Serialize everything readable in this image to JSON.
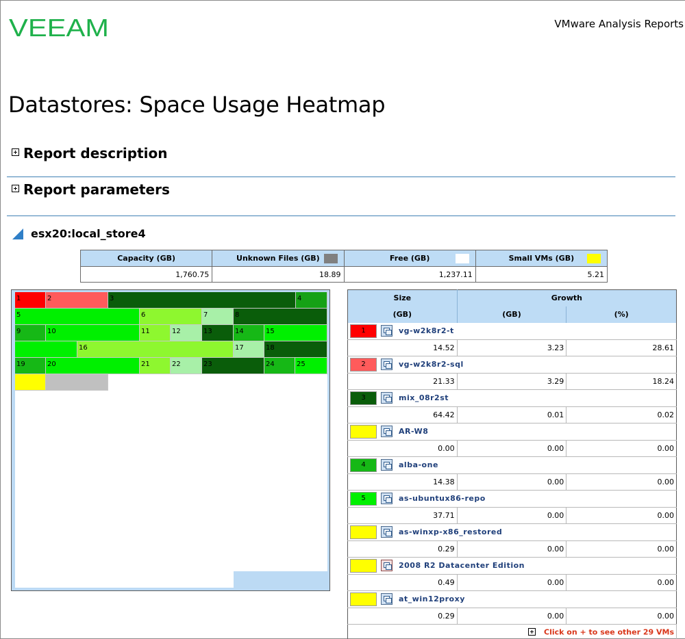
{
  "header": {
    "logo_text": "VEEAM",
    "report_name": "VMware Analysis Reports"
  },
  "page_title": "Datastores: Space Usage Heatmap",
  "sections": [
    {
      "label": "Report description"
    },
    {
      "label": "Report parameters"
    }
  ],
  "datastore": {
    "name": "esx20:local_store4"
  },
  "summary": {
    "headers": [
      "Capacity (GB)",
      "Unknown Files (GB)",
      "Free (GB)",
      "Small VMs (GB)"
    ],
    "values": [
      "1,760.75",
      "18.89",
      "1,237.11",
      "5.21"
    ],
    "swatch_colors": [
      "",
      "#808080",
      "#ffffff",
      "#ffff00"
    ]
  },
  "heatmap": {
    "cells": [
      {
        "label": "1",
        "color": "#ff0000"
      },
      {
        "label": "2",
        "color": "#ff5b5b"
      },
      {
        "label": "3",
        "color": "#0a5d0a"
      },
      {
        "label": "4",
        "color": "#16a116"
      },
      {
        "label": "5",
        "color": "#00f000"
      },
      {
        "label": "6",
        "color": "#8ef72f"
      },
      {
        "label": "7",
        "color": "#a8f0a8"
      },
      {
        "label": "8",
        "color": "#0a5d0a"
      },
      {
        "label": "9",
        "color": "#16b816"
      },
      {
        "label": "10",
        "color": "#00f000"
      },
      {
        "label": "11",
        "color": "#8ef72f"
      },
      {
        "label": "12",
        "color": "#a8f0a8"
      },
      {
        "label": "13",
        "color": "#0a5d0a"
      },
      {
        "label": "14",
        "color": "#16b816"
      },
      {
        "label": "15",
        "color": "#00f000"
      },
      {
        "label": "",
        "color": "#00f000"
      },
      {
        "label": "16",
        "color": "#8ef72f"
      },
      {
        "label": "17",
        "color": "#a8f0a8"
      },
      {
        "label": "18",
        "color": "#0a5d0a"
      },
      {
        "label": "19",
        "color": "#16b816"
      },
      {
        "label": "20",
        "color": "#00f000"
      },
      {
        "label": "21",
        "color": "#8ef72f"
      },
      {
        "label": "22",
        "color": "#a8f0a8"
      },
      {
        "label": "23",
        "color": "#0a5d0a"
      },
      {
        "label": "24",
        "color": "#16b816"
      },
      {
        "label": "25",
        "color": "#00f000"
      },
      {
        "label": "",
        "color": "#ffff00"
      },
      {
        "label": "",
        "color": "#c0c0c0"
      }
    ]
  },
  "vm_table": {
    "headers": {
      "size": "Size",
      "growth": "Growth",
      "size_unit": "(GB)",
      "growth_gb": "(GB)",
      "growth_pct": "(%)"
    },
    "rows": [
      {
        "num": "1",
        "color": "#ff0000",
        "icon": "vm-icon",
        "name": "vg-w2k8r2-t",
        "size": "14.52",
        "growth_gb": "3.23",
        "growth_pct": "28.61"
      },
      {
        "num": "2",
        "color": "#ff5b5b",
        "icon": "vm-icon",
        "name": "vg-w2k8r2-sql",
        "size": "21.33",
        "growth_gb": "3.29",
        "growth_pct": "18.24"
      },
      {
        "num": "3",
        "color": "#0a5d0a",
        "icon": "vm-icon",
        "name": "mix_08r2st",
        "size": "64.42",
        "growth_gb": "0.01",
        "growth_pct": "0.02"
      },
      {
        "num": "",
        "color": "#ffff00",
        "icon": "vm-icon",
        "name": "AR-W8",
        "size": "0.00",
        "growth_gb": "0.00",
        "growth_pct": "0.00"
      },
      {
        "num": "4",
        "color": "#16b816",
        "icon": "vm-icon",
        "name": "alba-one",
        "size": "14.38",
        "growth_gb": "0.00",
        "growth_pct": "0.00"
      },
      {
        "num": "5",
        "color": "#00f000",
        "icon": "vm-icon",
        "name": "as-ubuntux86-repo",
        "size": "37.71",
        "growth_gb": "0.00",
        "growth_pct": "0.00"
      },
      {
        "num": "",
        "color": "#ffff00",
        "icon": "vm-icon",
        "name": "as-winxp-x86_restored",
        "size": "0.29",
        "growth_gb": "0.00",
        "growth_pct": "0.00"
      },
      {
        "num": "",
        "color": "#ffff00",
        "icon": "template-icon",
        "name": "2008 R2 Datacenter Edition",
        "size": "0.49",
        "growth_gb": "0.00",
        "growth_pct": "0.00"
      },
      {
        "num": "",
        "color": "#ffff00",
        "icon": "vm-icon",
        "name": "at_win12proxy",
        "size": "0.29",
        "growth_gb": "0.00",
        "growth_pct": "0.00"
      }
    ],
    "more_label": "Click on + to see other 29 VMs"
  }
}
